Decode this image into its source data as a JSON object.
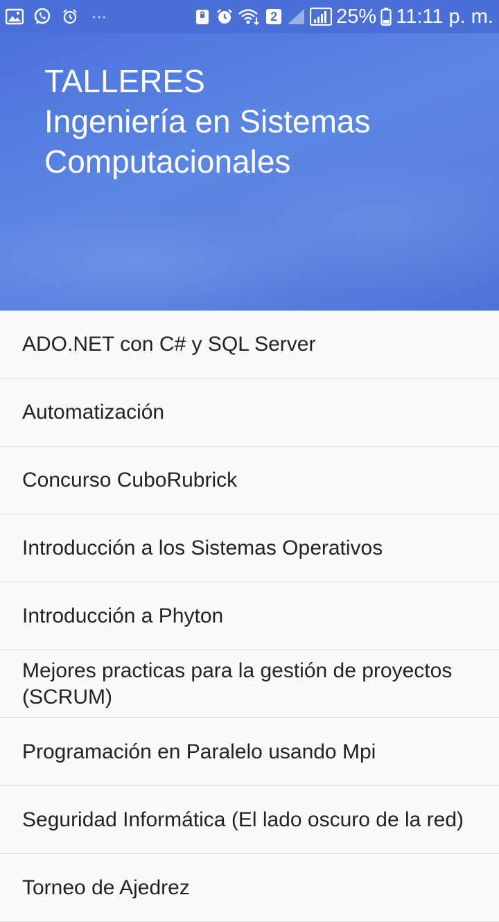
{
  "status_bar": {
    "left_icons": [
      "gallery-icon",
      "whatsapp-icon",
      "alarm-outline-icon",
      "more-dots-icon"
    ],
    "more": "···",
    "right_icons": [
      "nfc-lock-icon",
      "alarm-icon",
      "wifi-icon",
      "sim-2-icon",
      "signal-empty-icon",
      "signal-icon",
      "battery-icon"
    ],
    "sim_label": "2",
    "battery": "25%",
    "time": "11:11 p. m."
  },
  "header": {
    "line1": "TALLERES",
    "line2": "Ingeniería en Sistemas",
    "line3": "Computacionales"
  },
  "list": {
    "items": [
      {
        "label": "ADO.NET con C# y SQL Server"
      },
      {
        "label": "Automatización"
      },
      {
        "label": "Concurso CuboRubrick"
      },
      {
        "label": "Introducción a los Sistemas Operativos"
      },
      {
        "label": "Introducción a Phyton"
      },
      {
        "label": "Mejores practicas para la gestión de proyectos (SCRUM)"
      },
      {
        "label": "Programación en Paralelo usando Mpi"
      },
      {
        "label": "Seguridad Informática (El lado oscuro de la red)"
      },
      {
        "label": "Torneo  de Ajedrez"
      }
    ]
  },
  "colors": {
    "header": "#5a80e0",
    "list_background": "#fafafa",
    "divider": "#d9d9d9",
    "text": "#222222"
  }
}
